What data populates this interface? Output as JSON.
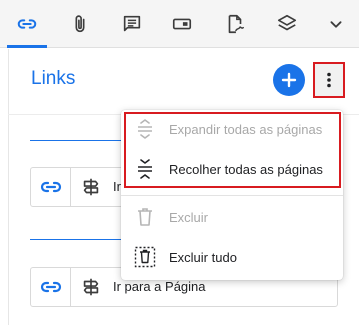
{
  "toolbar": {
    "tabs": [
      {
        "icon": "link-icon",
        "active": true
      },
      {
        "icon": "paperclip-icon",
        "active": false
      },
      {
        "icon": "comment-icon",
        "active": false
      },
      {
        "icon": "form-field-icon",
        "active": false
      },
      {
        "icon": "signature-file-icon",
        "active": false
      },
      {
        "icon": "layers-icon",
        "active": false
      },
      {
        "icon": "chevron-down-icon",
        "active": false
      }
    ]
  },
  "panel": {
    "title": "Links",
    "add_icon": "plus-icon",
    "more_icon": "more-vertical-icon",
    "rows": [
      {
        "label": "Ir",
        "link_icon": "link-icon",
        "action_icon": "signpost-icon"
      },
      {
        "label": "Ir para a Página",
        "link_icon": "link-icon",
        "action_icon": "signpost-icon"
      }
    ]
  },
  "menu": {
    "items": [
      {
        "label": "Expandir todas as páginas",
        "icon": "expand-icon",
        "disabled": true
      },
      {
        "label": "Recolher todas as páginas",
        "icon": "collapse-icon",
        "disabled": false
      },
      {
        "label": "Excluir",
        "icon": "trash-icon",
        "disabled": true
      },
      {
        "label": "Excluir tudo",
        "icon": "delete-all-icon",
        "disabled": false
      }
    ]
  },
  "colors": {
    "accent": "#1a73e8",
    "highlight": "#d81b20",
    "disabled": "#a8a8a8"
  }
}
